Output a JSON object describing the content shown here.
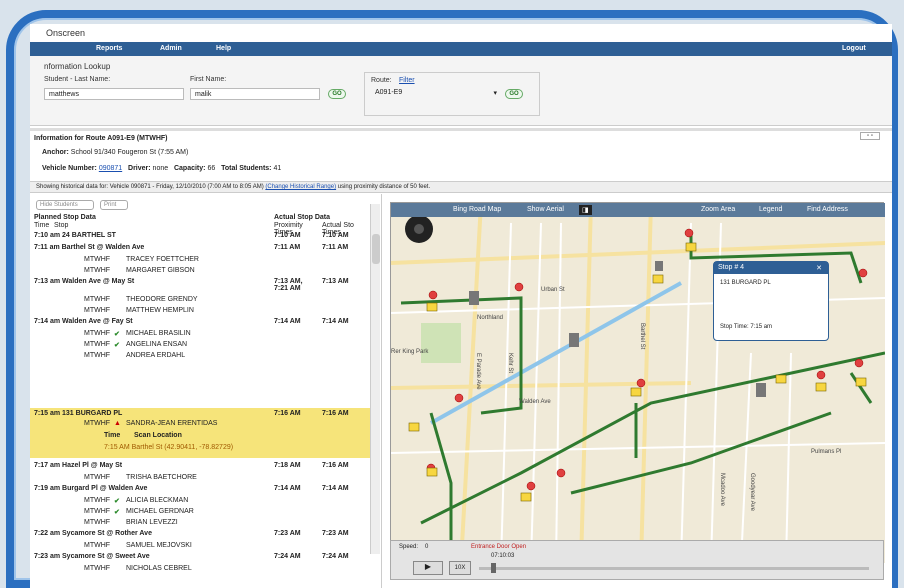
{
  "app": {
    "title": "Onscreen"
  },
  "menu": [
    "Reports",
    "Admin",
    "Help"
  ],
  "logout_label": "Logout",
  "lookup": {
    "heading": "nformation Lookup",
    "student_last_label": "Student - Last Name:",
    "student_last_value": "matthews",
    "first_name_label": "First Name:",
    "first_name_value": "malik",
    "go_label": "GO",
    "route_label": "Route:",
    "route_filter_link": "Filter",
    "route_value": "A091-E9"
  },
  "route_info": {
    "heading": "Information for Route A091-E9 (MTWHF)",
    "anchor_label": "Anchor:",
    "anchor_value": "School 91/340 Fougeron St (7:55 AM)",
    "vehicle_label": "Vehicle Number:",
    "vehicle_value": "090871",
    "driver_label": "Driver:",
    "driver_value": "none",
    "capacity_label": "Capacity:",
    "capacity_value": "66",
    "total_label": "Total Students:",
    "total_value": "41"
  },
  "historical": {
    "text": "Showing historical data for: Vehicle 090871 - Friday, 12/10/2010 (7:00 AM to 8:05 AM)",
    "link": "(Change Historical Range)",
    "suffix": "using proximity distance of 50 feet."
  },
  "stops_panel": {
    "hide_students": "Hide Students",
    "print": "Print",
    "planned_heading": "Planned Stop Data",
    "col_time": "Time",
    "col_stop": "Stop",
    "actual_heading": "Actual Stop Data",
    "col_proximity": "Proximity Times",
    "col_actual": "Actual Sto Times",
    "rows": [
      {
        "kind": "stop",
        "text": "7:10 am 24 BARTHEL ST",
        "prox": "7:10 AM",
        "act": "7:10 AM"
      },
      {
        "kind": "stop",
        "text": "7:11 am Barthel St @ Walden Ave",
        "prox": "7:11 AM",
        "act": "7:11 AM"
      },
      {
        "kind": "student",
        "days": "MTWHF",
        "name": "TRACEY FOETTCHER"
      },
      {
        "kind": "student",
        "days": "MTWHF",
        "name": "MARGARET GIBSON"
      },
      {
        "kind": "stop",
        "text": "7:13 am Walden Ave @ May St",
        "prox": "7:13 AM, 7:21 AM",
        "act": "7:13 AM"
      },
      {
        "kind": "student",
        "days": "MTWHF",
        "name": "THEODORE GRENDY"
      },
      {
        "kind": "student",
        "days": "MTWHF",
        "name": "MATTHEW HEMPLIN"
      },
      {
        "kind": "stop",
        "text": "7:14 am Walden Ave @ Fay St",
        "prox": "7:14 AM",
        "act": "7:14 AM"
      },
      {
        "kind": "student",
        "days": "MTWHF",
        "name": "MICHAEL BRASILIN",
        "mark": "check"
      },
      {
        "kind": "student",
        "days": "MTWHF",
        "name": "ANGELINA ENSAN",
        "mark": "check"
      },
      {
        "kind": "student",
        "days": "MTWHF",
        "name": "ANDREA ERDAHL"
      }
    ],
    "highlight": {
      "stop": "7:15 am 131 BURGARD PL",
      "prox": "7:16 AM",
      "act": "7:16 AM",
      "days": "MTWHF",
      "student": "SANDRA-JEAN ERENTIDAS",
      "scan_time_label": "Time",
      "scan_loc_label": "Scan Location",
      "scan_line": "7:15 AM Barthel St (42.90411, -78.82729)"
    },
    "rows2": [
      {
        "kind": "stop",
        "text": "7:17 am Hazel Pl @ May St",
        "prox": "7:18 AM",
        "act": "7:16 AM"
      },
      {
        "kind": "student",
        "days": "MTWHF",
        "name": "TRISHA BAETCHORE"
      },
      {
        "kind": "stop",
        "text": "7:19 am Burgard Pl @ Walden Ave",
        "prox": "7:14 AM",
        "act": "7:14 AM"
      },
      {
        "kind": "student",
        "days": "MTWHF",
        "name": "ALICIA BLECKMAN",
        "mark": "check"
      },
      {
        "kind": "student",
        "days": "MTWHF",
        "name": "MICHAEL GERDNAR",
        "mark": "check"
      },
      {
        "kind": "student",
        "days": "MTWHF",
        "name": "BRIAN LEVEZZI"
      },
      {
        "kind": "stop",
        "text": "7:22 am Sycamore St @ Rother Ave",
        "prox": "7:23 AM",
        "act": "7:23 AM"
      },
      {
        "kind": "student",
        "days": "MTWHF",
        "name": "SAMUEL MEJOVSKI"
      },
      {
        "kind": "stop",
        "text": "7:23 am Sycamore St @ Sweet Ave",
        "prox": "7:24 AM",
        "act": "7:24 AM"
      },
      {
        "kind": "student",
        "days": "MTWHF",
        "name": "NICHOLAS CEBREL"
      }
    ]
  },
  "map": {
    "toolbar": {
      "road": "Bing Road Map",
      "show_aerial": "Show Aerial",
      "zoom_area": "Zoom Area",
      "legend": "Legend",
      "find_address": "Find Address"
    },
    "popup": {
      "title": "Stop # 4",
      "address": "131 BURGARD PL",
      "stop_time_label": "Stop Time:",
      "stop_time_value": "7:15 am"
    },
    "street_labels": [
      "Urban St",
      "Northland",
      "Walden Ave",
      "Rer King Park",
      "E Parade Ave",
      "Kehr St",
      "Goodyear Ave",
      "Pulmans Pl",
      "Mcadoo Ave",
      "Barthel St"
    ]
  },
  "player": {
    "speed_label": "Speed:",
    "speed_value": "0",
    "event": "Entrance Door Open",
    "time": "07:10:03",
    "rate": "10X"
  }
}
